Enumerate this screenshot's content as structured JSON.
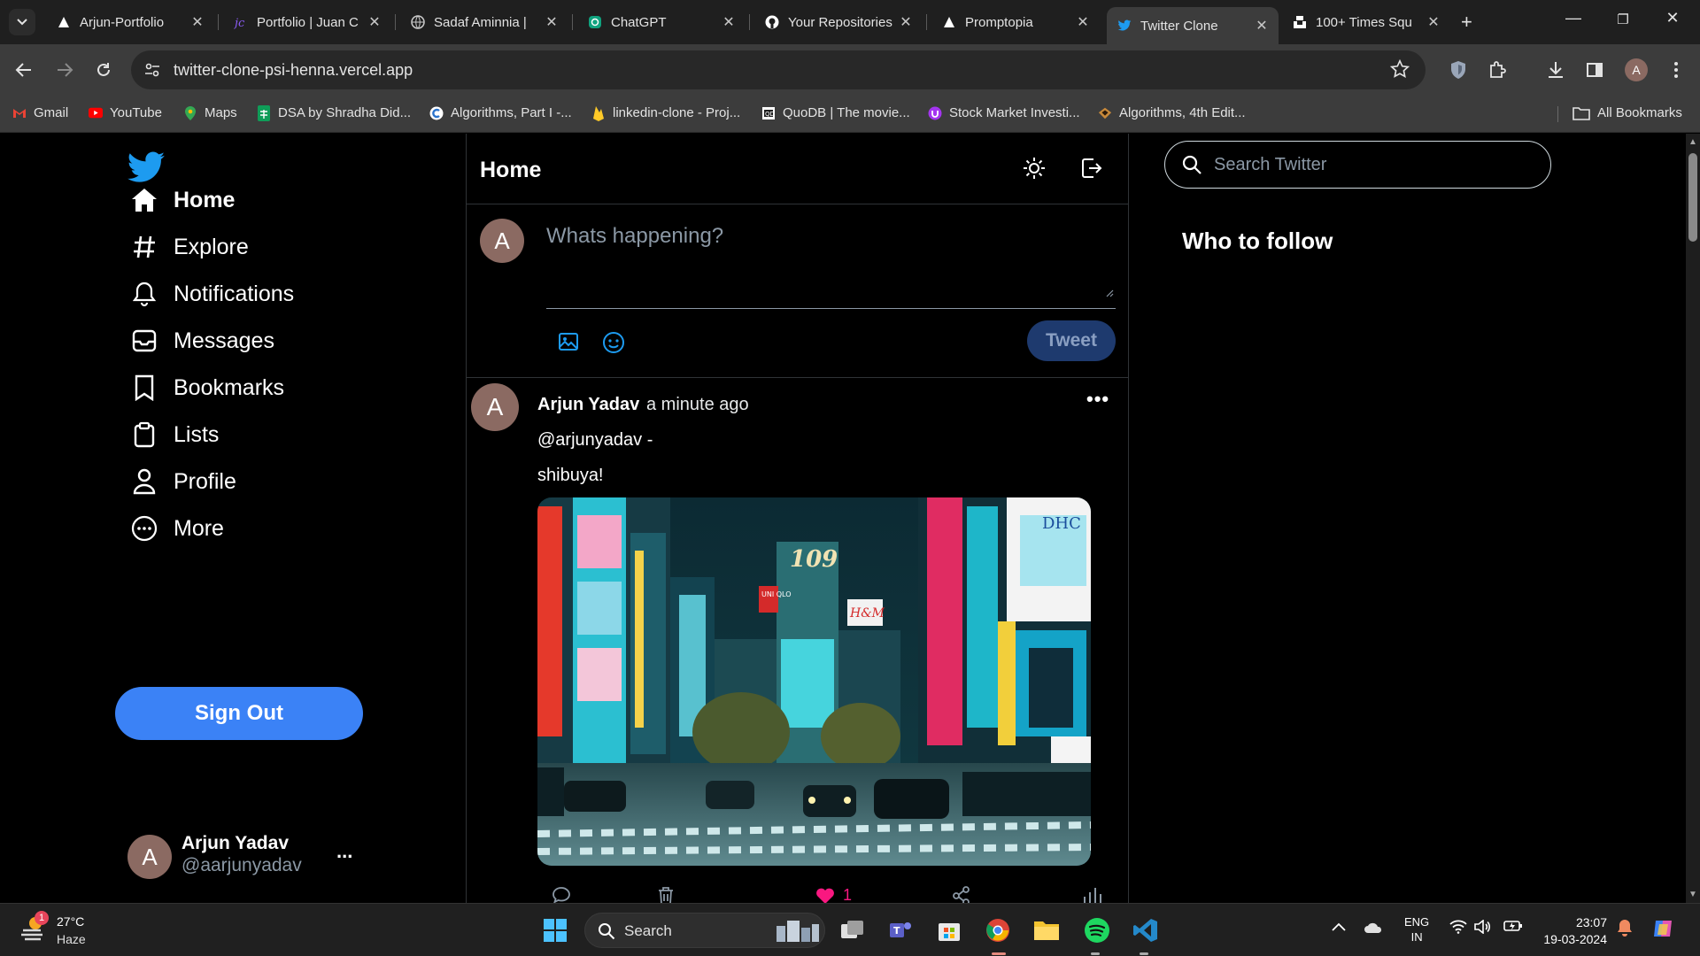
{
  "browser": {
    "tabs": [
      {
        "title": "Arjun-Portfolio",
        "icon": "triangle-icon"
      },
      {
        "title": "Portfolio | Juan C",
        "icon": "jc-icon"
      },
      {
        "title": "Sadaf Aminnia |",
        "icon": "globe-icon"
      },
      {
        "title": "ChatGPT",
        "icon": "chatgpt-icon"
      },
      {
        "title": "Your Repositories",
        "icon": "github-icon"
      },
      {
        "title": "Promptopia",
        "icon": "triangle-icon"
      },
      {
        "title": "Twitter Clone",
        "icon": "twitter-icon",
        "active": true
      },
      {
        "title": "100+ Times Squ",
        "icon": "unsplash-icon"
      }
    ],
    "url": "twitter-clone-psi-henna.vercel.app",
    "bookmarks": [
      {
        "label": "Gmail",
        "icon": "gmail-icon"
      },
      {
        "label": "YouTube",
        "icon": "youtube-icon"
      },
      {
        "label": "Maps",
        "icon": "maps-icon"
      },
      {
        "label": "DSA by Shradha Did...",
        "icon": "sheets-icon"
      },
      {
        "label": "Algorithms, Part I -...",
        "icon": "coursera-icon"
      },
      {
        "label": "linkedin-clone - Proj...",
        "icon": "firebase-icon"
      },
      {
        "label": "QuoDB | The movie...",
        "icon": "quodb-icon"
      },
      {
        "label": "Stock Market Investi...",
        "icon": "udemy-icon"
      },
      {
        "label": "Algorithms, 4th Edit...",
        "icon": "book-icon"
      }
    ],
    "all_bookmarks": "All Bookmarks",
    "profile_initial": "A"
  },
  "sidebar": {
    "nav": [
      {
        "label": "Home",
        "icon": "home-icon",
        "active": true
      },
      {
        "label": "Explore",
        "icon": "hashtag-icon"
      },
      {
        "label": "Notifications",
        "icon": "bell-icon"
      },
      {
        "label": "Messages",
        "icon": "inbox-icon"
      },
      {
        "label": "Bookmarks",
        "icon": "bookmark-icon"
      },
      {
        "label": "Lists",
        "icon": "clipboard-icon"
      },
      {
        "label": "Profile",
        "icon": "user-icon"
      },
      {
        "label": "More",
        "icon": "more-circle-icon"
      }
    ],
    "sign_out": "Sign Out",
    "user": {
      "initial": "A",
      "name": "Arjun Yadav",
      "handle": "@aarjunyadav",
      "menu": "..."
    }
  },
  "center": {
    "title": "Home",
    "composer": {
      "initial": "A",
      "placeholder": "Whats happening?",
      "tweet_label": "Tweet"
    },
    "post": {
      "initial": "A",
      "author": "Arjun Yadav",
      "time": "a minute ago",
      "handle": "@arjunyadav -",
      "text": "shibuya!",
      "more": "•••",
      "likes": "1",
      "photo_signs": {
        "dept_store": "109",
        "uniqlo": "UNI QLO",
        "hm": "H&M",
        "dhc": "DHC"
      }
    }
  },
  "right": {
    "search_placeholder": "Search Twitter",
    "who_to_follow": "Who to follow"
  },
  "taskbar": {
    "weather": {
      "temp": "27°C",
      "condition": "Haze",
      "badge": "1"
    },
    "search_label": "Search",
    "lang": {
      "line1": "ENG",
      "line2": "IN"
    },
    "clock": {
      "time": "23:07",
      "date": "19-03-2024"
    }
  },
  "colors": {
    "accent": "#1d9bf0",
    "signout": "#3b82f6",
    "like": "#f91880",
    "avatar": "#8b6a62"
  }
}
